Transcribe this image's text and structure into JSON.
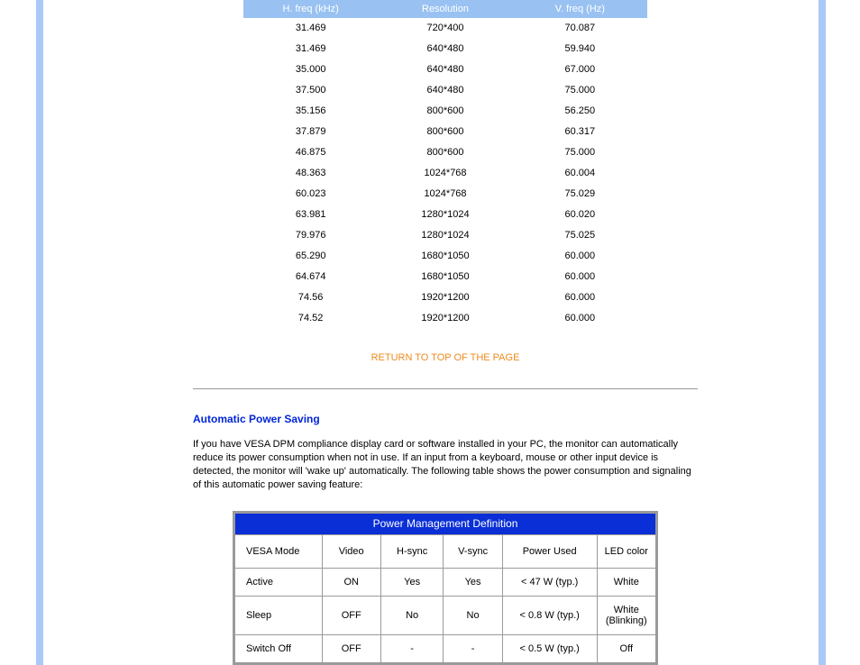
{
  "table1": {
    "headers": [
      "H. freq (kHz)",
      "Resolution",
      "V. freq (Hz)"
    ],
    "rows": [
      [
        "31.469",
        "720*400",
        "70.087"
      ],
      [
        "31.469",
        "640*480",
        "59.940"
      ],
      [
        "35.000",
        "640*480",
        "67.000"
      ],
      [
        "37.500",
        "640*480",
        "75.000"
      ],
      [
        "35.156",
        "800*600",
        "56.250"
      ],
      [
        "37.879",
        "800*600",
        "60.317"
      ],
      [
        "46.875",
        "800*600",
        "75.000"
      ],
      [
        "48.363",
        "1024*768",
        "60.004"
      ],
      [
        "60.023",
        "1024*768",
        "75.029"
      ],
      [
        "63.981",
        "1280*1024",
        "60.020"
      ],
      [
        "79.976",
        "1280*1024",
        "75.025"
      ],
      [
        "65.290",
        "1680*1050",
        "60.000"
      ],
      [
        "64.674",
        "1680*1050",
        "60.000"
      ],
      [
        "74.56",
        "1920*1200",
        "60.000"
      ],
      [
        "74.52",
        "1920*1200",
        "60.000"
      ]
    ]
  },
  "return_link": "RETURN TO TOP OF THE PAGE",
  "section_heading": "Automatic Power Saving",
  "paragraph": "If you have VESA DPM compliance display card or software installed in your PC, the monitor can automatically reduce its power consumption when not in use. If an input from a keyboard, mouse or other input device is detected, the monitor will 'wake up' automatically. The following table shows the power consumption and signaling of this automatic power saving feature:",
  "table2": {
    "title": "Power Management Definition",
    "headers": [
      "VESA Mode",
      "Video",
      "H-sync",
      "V-sync",
      "Power Used",
      "LED color"
    ],
    "rows": [
      [
        "Active",
        "ON",
        "Yes",
        "Yes",
        "< 47 W (typ.)",
        "White"
      ],
      [
        "Sleep",
        "OFF",
        "No",
        "No",
        "< 0.8 W (typ.)",
        "White (Blinking)"
      ],
      [
        "Switch Off",
        "OFF",
        "-",
        "-",
        "< 0.5 W (typ.)",
        "Off"
      ]
    ]
  }
}
